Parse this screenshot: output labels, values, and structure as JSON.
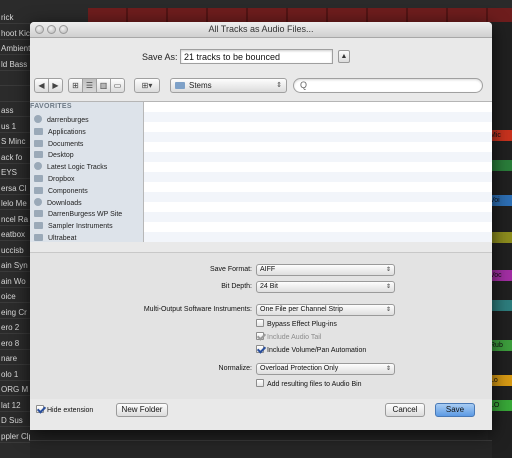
{
  "background": {
    "track_labels": [
      "rick",
      "hoot Kic",
      "Ambient",
      "ld Bass",
      "",
      "",
      "ass",
      "us 1",
      "S Minc",
      "ack fo",
      "EYS",
      "ersa Cl",
      "lelo Me",
      "ncel Ra",
      "eatbox",
      "uccisb",
      "ain Syn",
      "ain Wo",
      "oice",
      "eing Cr",
      "ero 2",
      "ero 8",
      "nare",
      "olo 1",
      "ORG M",
      "lat 12",
      "D Sus",
      "ppler Clp"
    ],
    "right_regions": [
      "Mic",
      "",
      "Voi",
      "",
      "Voc",
      "",
      "Rub",
      "Lo",
      "LO"
    ]
  },
  "dialog": {
    "title": "All Tracks as Audio Files...",
    "save_as_label": "Save As:",
    "save_as_value": "21 tracks to be bounced",
    "disclosure_symbol": "▲",
    "toolbar": {
      "back_symbol": "◀",
      "forward_symbol": "▶",
      "view_icon_symbol": "⊞",
      "view_list_symbol": "☰",
      "view_column_symbol": "▥",
      "view_coverflow_symbol": "▭",
      "arrange_symbol": "⊞▾",
      "location": "Stems",
      "search_placeholder": "Q"
    },
    "sidebar": {
      "header": "FAVORITES",
      "items": [
        {
          "label": "darrenburges",
          "icon": "home-icon"
        },
        {
          "label": "Applications",
          "icon": "applications-icon"
        },
        {
          "label": "Documents",
          "icon": "documents-icon"
        },
        {
          "label": "Desktop",
          "icon": "desktop-icon"
        },
        {
          "label": "Latest Logic Tracks",
          "icon": "gear-folder-icon"
        },
        {
          "label": "Dropbox",
          "icon": "folder-icon"
        },
        {
          "label": "Components",
          "icon": "folder-icon"
        },
        {
          "label": "Downloads",
          "icon": "downloads-icon"
        },
        {
          "label": "DarrenBurgess WP Site",
          "icon": "folder-icon"
        },
        {
          "label": "Sampler Instruments",
          "icon": "folder-icon"
        },
        {
          "label": "Ultrabeat",
          "icon": "folder-icon"
        }
      ]
    },
    "options": {
      "save_format_label": "Save Format:",
      "save_format_value": "AIFF",
      "bit_depth_label": "Bit Depth:",
      "bit_depth_value": "24 Bit",
      "multi_output_label": "Multi-Output Software Instruments:",
      "multi_output_value": "One File per Channel Strip",
      "bypass_label": "Bypass Effect Plug-ins",
      "bypass_checked": false,
      "audio_tail_label": "Include Audio Tail",
      "audio_tail_checked": true,
      "volpan_label": "Include Volume/Pan Automation",
      "volpan_checked": true,
      "normalize_label": "Normalize:",
      "normalize_value": "Overload Protection Only",
      "add_to_bin_label": "Add resulting files to Audio Bin",
      "add_to_bin_checked": false
    },
    "bottom": {
      "hide_extension_label": "Hide extension",
      "hide_extension_checked": true,
      "new_folder_label": "New Folder",
      "cancel_label": "Cancel",
      "save_label": "Save"
    }
  },
  "colors": {
    "accent_default_button": "#5c9ae4",
    "sidebar_bg": "#dde3ea",
    "clip_red": "#7a1b1b"
  }
}
